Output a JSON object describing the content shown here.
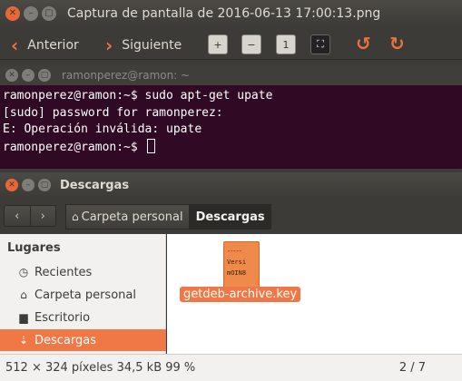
{
  "viewer": {
    "title": "Captura de pantalla de 2016-06-13 17:00:13.png",
    "prev_label": "Anterior",
    "next_label": "Siguiente"
  },
  "terminal": {
    "title": "ramonperez@ramon: ~",
    "lines": [
      "ramonperez@ramon:~$ sudo apt-get upate",
      "[sudo] password for ramonperez:",
      "E: Operación inválida: upate",
      "ramonperez@ramon:~$ "
    ]
  },
  "file_manager": {
    "title": "Descargas",
    "breadcrumbs": [
      "Carpeta personal",
      "Descargas"
    ],
    "sidebar_heading": "Lugares",
    "sidebar_items": [
      "Recientes",
      "Carpeta personal",
      "Escritorio",
      "Descargas"
    ],
    "file_icon_lines": [
      "Versi",
      "mOIN8"
    ],
    "file_name": "getdeb-archive.key"
  },
  "status": {
    "info": "512 × 324 píxeles  34,5 kB  99 %",
    "position": "2 / 7"
  },
  "colors": {
    "accent": "#f07746",
    "terminal_bg": "#300a24",
    "titlebar_bg": "#3c3b37"
  }
}
